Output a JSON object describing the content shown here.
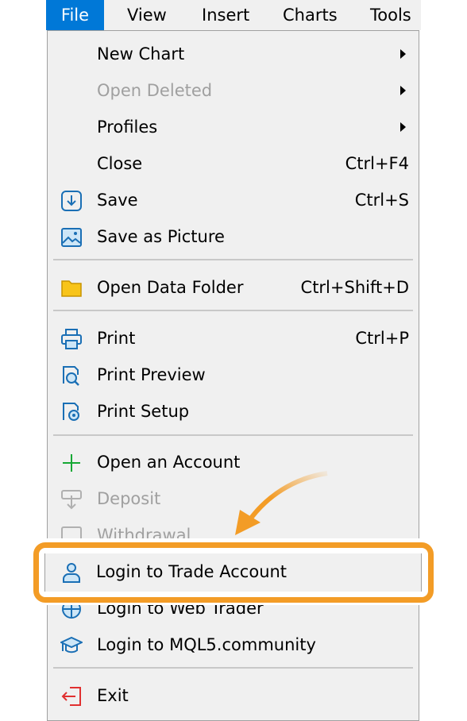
{
  "menubar": [
    "File",
    "View",
    "Insert",
    "Charts",
    "Tools"
  ],
  "items": [
    {
      "label": "New Chart",
      "submenu": true
    },
    {
      "label": "Open Deleted",
      "submenu": true,
      "disabled": true
    },
    {
      "label": "Profiles",
      "submenu": true
    },
    {
      "label": "Close",
      "shortcut": "Ctrl+F4"
    },
    {
      "label": "Save",
      "shortcut": "Ctrl+S",
      "icon": "save-icon"
    },
    {
      "label": "Save as Picture",
      "icon": "picture-icon"
    },
    {
      "label": "Open Data Folder",
      "shortcut": "Ctrl+Shift+D",
      "icon": "folder-icon"
    },
    {
      "label": "Print",
      "shortcut": "Ctrl+P",
      "icon": "printer-icon"
    },
    {
      "label": "Print Preview",
      "icon": "print-preview-icon"
    },
    {
      "label": "Print Setup",
      "icon": "print-setup-icon"
    },
    {
      "label": "Open an Account",
      "icon": "plus-icon"
    },
    {
      "label": "Deposit",
      "disabled": true,
      "icon": "deposit-icon"
    },
    {
      "label": "Withdrawal",
      "disabled": true,
      "icon": "withdrawal-icon"
    },
    {
      "label": "Login to Trade Account",
      "icon": "user-icon",
      "highlighted": true
    },
    {
      "label": "Login to Web Trader",
      "icon": "globe-icon"
    },
    {
      "label": "Login to MQL5.community",
      "icon": "graduation-cap-icon"
    },
    {
      "label": "Exit",
      "icon": "exit-icon"
    }
  ],
  "colors": {
    "accent": "#0078d7",
    "highlight": "#f39c26",
    "icon": "#1a6fb5"
  }
}
